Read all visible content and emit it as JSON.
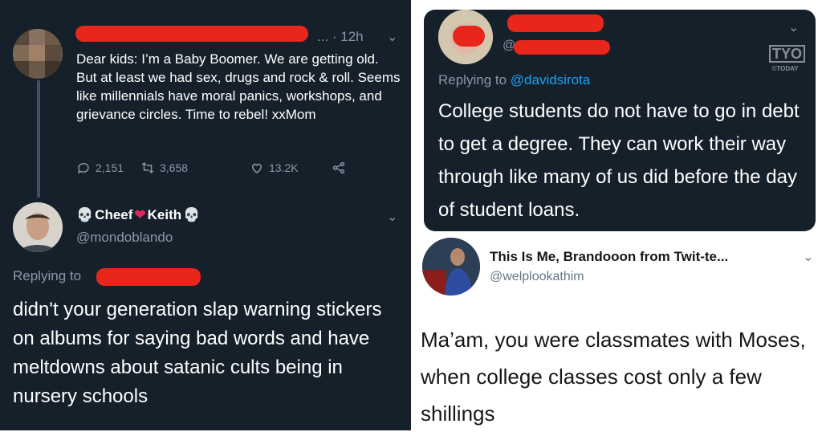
{
  "tweet1": {
    "time": "... · 12h",
    "text": "Dear kids: I’m a Baby Boomer. We are getting old. But at least we had sex, drugs and rock & roll. Seems like millennials have moral panics, workshops, and grievance circles. Time to rebel! xxMom",
    "replies": "2,151",
    "retweets": "3,658",
    "likes": "13.2K"
  },
  "tweet2": {
    "name_part1": "Cheef",
    "name_part2": "Keith",
    "handle": "@mondoblando",
    "replying_to": "Replying to",
    "text": "didn't your generation slap warning stickers on albums for saying bad words and have meltdowns about satanic cults being in nursery schools"
  },
  "tweet3": {
    "handle_prefix": "@",
    "replying_to": "Replying to",
    "mention": "@davidsirota",
    "text": "College students do not have to go in debt to get a degree. They can work their way through like many of us did before the day of student loans.",
    "watermark_main": "TYO",
    "watermark_sub": "©TODAY"
  },
  "tweet4": {
    "name": "This Is Me, Brandooon from Twit-te...",
    "handle": "@welplookathim",
    "text": "Ma’am, you were classmates with Moses, when college classes cost only a few shillings"
  },
  "colors": {
    "dark_bg": "#15202b",
    "redaction": "#e8261c",
    "link_blue": "#1da1f2",
    "muted": "#8899a6"
  },
  "icons": [
    "reply-icon",
    "retweet-icon",
    "like-icon",
    "share-icon",
    "chevron-down-icon",
    "skull-icon",
    "heart-icon"
  ]
}
